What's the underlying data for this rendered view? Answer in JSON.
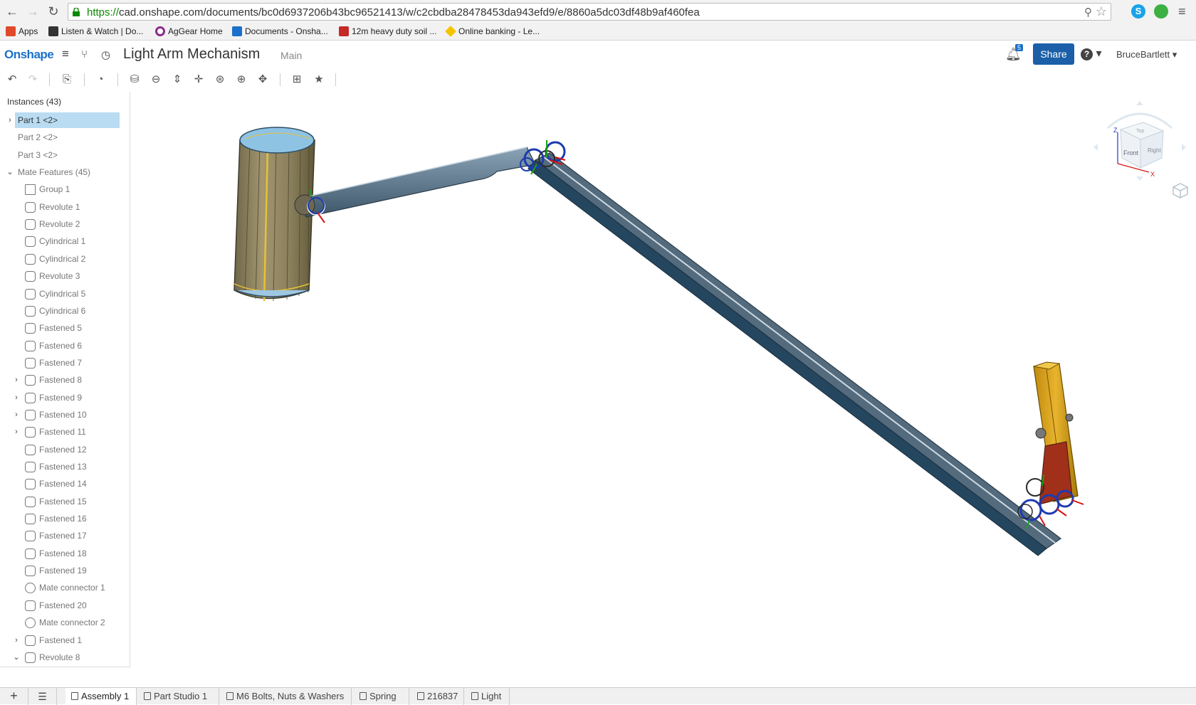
{
  "browser": {
    "url_prefix": "https://",
    "url_host": "cad.onshape.com",
    "url_path": "/documents/bc0d6937206b43bc96521413/w/c2cbdba28478453da943efd9/e/8860a5dc03df48b9af460fea",
    "bookmarks": [
      {
        "label": "Apps",
        "color": "#e04a2a"
      },
      {
        "label": "Listen & Watch | Do...",
        "color": "#333333"
      },
      {
        "label": "AgGear Home",
        "color": "#8b2c8b"
      },
      {
        "label": "Documents - Onsha...",
        "color": "#1b70c9"
      },
      {
        "label": "12m heavy duty soil ...",
        "color": "#c62828"
      },
      {
        "label": "Online banking - Le...",
        "color": "#f5c400"
      }
    ]
  },
  "header": {
    "logo": "Onshape",
    "doc_title": "Light Arm Mechanism",
    "workspace": "Main",
    "notification_count": "5",
    "share_label": "Share",
    "help_label": "?",
    "user": "BruceBartlett"
  },
  "panel": {
    "title": "Instances (43)",
    "rows": [
      {
        "label": "Part 1 <2>",
        "indent": 0,
        "chev": "›",
        "icon": "",
        "selected": true
      },
      {
        "label": "Part 2 <2>",
        "indent": 0,
        "chev": "",
        "icon": "",
        "selected": false
      },
      {
        "label": "Part 3 <2>",
        "indent": 0,
        "chev": "",
        "icon": "",
        "selected": false
      },
      {
        "label": "Mate Features (45)",
        "indent": 0,
        "chev": "⌄",
        "icon": "",
        "selected": false
      },
      {
        "label": "Group 1",
        "indent": 1,
        "chev": "",
        "icon": "group",
        "selected": false
      },
      {
        "label": "Revolute 1",
        "indent": 1,
        "chev": "",
        "icon": "revolute",
        "selected": false
      },
      {
        "label": "Revolute 2",
        "indent": 1,
        "chev": "",
        "icon": "revolute",
        "selected": false
      },
      {
        "label": "Cylindrical 1",
        "indent": 1,
        "chev": "",
        "icon": "cylindrical",
        "selected": false
      },
      {
        "label": "Cylindrical 2",
        "indent": 1,
        "chev": "",
        "icon": "cylindrical",
        "selected": false
      },
      {
        "label": "Revolute 3",
        "indent": 1,
        "chev": "",
        "icon": "revolute",
        "selected": false
      },
      {
        "label": "Cylindrical 5",
        "indent": 1,
        "chev": "",
        "icon": "cylindrical",
        "selected": false
      },
      {
        "label": "Cylindrical 6",
        "indent": 1,
        "chev": "",
        "icon": "cylindrical",
        "selected": false
      },
      {
        "label": "Fastened 5",
        "indent": 1,
        "chev": "",
        "icon": "fastened",
        "selected": false
      },
      {
        "label": "Fastened 6",
        "indent": 1,
        "chev": "",
        "icon": "fastened",
        "selected": false
      },
      {
        "label": "Fastened 7",
        "indent": 1,
        "chev": "",
        "icon": "fastened",
        "selected": false
      },
      {
        "label": "Fastened 8",
        "indent": 1,
        "chev": "›",
        "icon": "fastened",
        "selected": false
      },
      {
        "label": "Fastened 9",
        "indent": 1,
        "chev": "›",
        "icon": "fastened",
        "selected": false
      },
      {
        "label": "Fastened 10",
        "indent": 1,
        "chev": "›",
        "icon": "fastened",
        "selected": false
      },
      {
        "label": "Fastened 11",
        "indent": 1,
        "chev": "›",
        "icon": "fastened",
        "selected": false
      },
      {
        "label": "Fastened 12",
        "indent": 1,
        "chev": "",
        "icon": "fastened",
        "selected": false
      },
      {
        "label": "Fastened 13",
        "indent": 1,
        "chev": "",
        "icon": "fastened",
        "selected": false
      },
      {
        "label": "Fastened 14",
        "indent": 1,
        "chev": "",
        "icon": "fastened",
        "selected": false
      },
      {
        "label": "Fastened 15",
        "indent": 1,
        "chev": "",
        "icon": "fastened",
        "selected": false
      },
      {
        "label": "Fastened 16",
        "indent": 1,
        "chev": "",
        "icon": "fastened",
        "selected": false
      },
      {
        "label": "Fastened 17",
        "indent": 1,
        "chev": "",
        "icon": "fastened",
        "selected": false
      },
      {
        "label": "Fastened 18",
        "indent": 1,
        "chev": "",
        "icon": "fastened",
        "selected": false
      },
      {
        "label": "Fastened 19",
        "indent": 1,
        "chev": "",
        "icon": "fastened",
        "selected": false
      },
      {
        "label": "Mate connector 1",
        "indent": 1,
        "chev": "",
        "icon": "connector",
        "selected": false
      },
      {
        "label": "Fastened 20",
        "indent": 1,
        "chev": "",
        "icon": "fastened",
        "selected": false
      },
      {
        "label": "Mate connector 2",
        "indent": 1,
        "chev": "",
        "icon": "connector",
        "selected": false
      },
      {
        "label": "Fastened 1",
        "indent": 1,
        "chev": "›",
        "icon": "fastened",
        "selected": false
      },
      {
        "label": "Revolute 8",
        "indent": 1,
        "chev": "⌄",
        "icon": "revolute",
        "selected": false
      }
    ]
  },
  "viewcube": {
    "top": "Top",
    "front": "Front",
    "right": "Right",
    "axis_x": "X",
    "axis_z": "Z"
  },
  "tabs": [
    {
      "label": "Assembly 1",
      "active": true
    },
    {
      "label": "Part Studio 1",
      "active": false
    },
    {
      "label": "M6 Bolts, Nuts & Washers",
      "active": false
    },
    {
      "label": "Spring",
      "active": false
    },
    {
      "label": "216837",
      "active": false
    },
    {
      "label": "Light",
      "active": false
    }
  ],
  "colors": {
    "accent": "#1b70c9",
    "selection": "#b9dcf2",
    "arm": "#4a6478",
    "bracket": "#d8a21c",
    "cylinder": "#8f8563"
  }
}
